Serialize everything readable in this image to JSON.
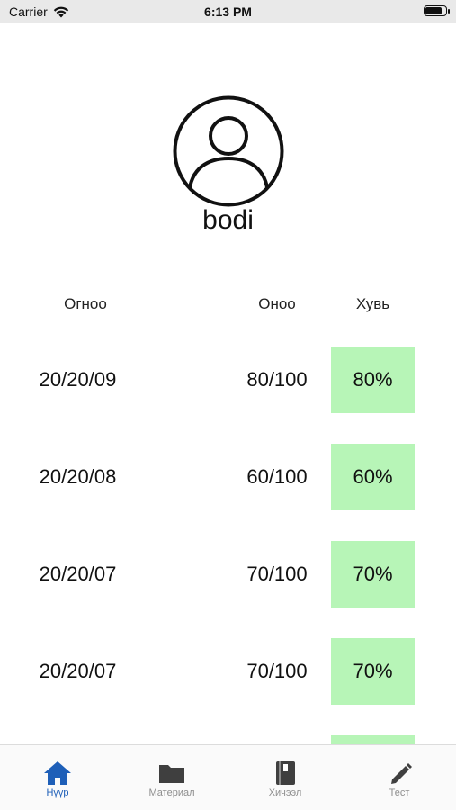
{
  "status_bar": {
    "carrier": "Carrier",
    "time": "6:13 PM",
    "battery_level": 0.92
  },
  "profile": {
    "username": "bodi",
    "avatar_icon": "user-circle-icon"
  },
  "table": {
    "headers": {
      "date": "Огноо",
      "score": "Оноо",
      "percent": "Хувь"
    },
    "rows": [
      {
        "date": "20/20/09",
        "score": "80/100",
        "percent": "80%"
      },
      {
        "date": "20/20/08",
        "score": "60/100",
        "percent": "60%"
      },
      {
        "date": "20/20/07",
        "score": "70/100",
        "percent": "70%"
      },
      {
        "date": "20/20/07",
        "score": "70/100",
        "percent": "70%"
      }
    ],
    "percent_cell_color": "#b7f5b7"
  },
  "tab_bar": {
    "tabs": [
      {
        "label": "Нүүр",
        "icon": "home-icon",
        "active": true
      },
      {
        "label": "Материал",
        "icon": "folder-icon",
        "active": false
      },
      {
        "label": "Хичээл",
        "icon": "book-icon",
        "active": false
      },
      {
        "label": "Тест",
        "icon": "pencil-icon",
        "active": false
      }
    ],
    "active_color": "#1e5fb8",
    "inactive_color": "#8e8e8e"
  }
}
